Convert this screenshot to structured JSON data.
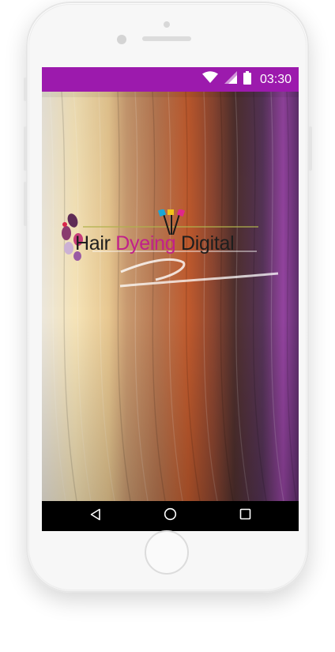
{
  "status_bar": {
    "time": "03:30",
    "background": "#9c1aad",
    "icons": [
      "wifi-icon",
      "cell-signal-icon",
      "battery-icon"
    ]
  },
  "splash": {
    "logo": {
      "word_1": "Hair",
      "word_2": "Dyeing",
      "word_3": "Digital",
      "accent_color": "#c2208a"
    },
    "background_colors": [
      "#f1e4c3",
      "#c98a5c",
      "#a8532a",
      "#5a3a4e",
      "#8a3f9d"
    ]
  },
  "nav_bar": {
    "buttons": [
      "back-icon",
      "home-icon",
      "recents-icon"
    ]
  }
}
